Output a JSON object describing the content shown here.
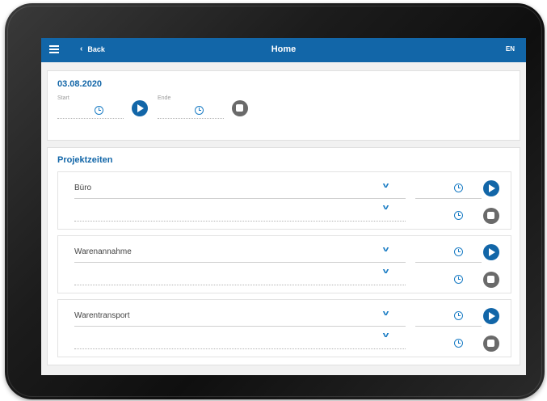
{
  "appbar": {
    "back_label": "Back",
    "title": "Home",
    "language": "EN"
  },
  "top_card": {
    "date": "03.08.2020",
    "start_label": "Start",
    "end_label": "Ende"
  },
  "projects_section": {
    "title": "Projektzeiten",
    "projects": [
      {
        "name": "Büro"
      },
      {
        "name": "Warenannahme"
      },
      {
        "name": "Warentransport"
      }
    ]
  },
  "colors": {
    "primary": "#1266a8",
    "stop_gray": "#6a6a6a",
    "icon_blue": "#1a7cc4"
  }
}
